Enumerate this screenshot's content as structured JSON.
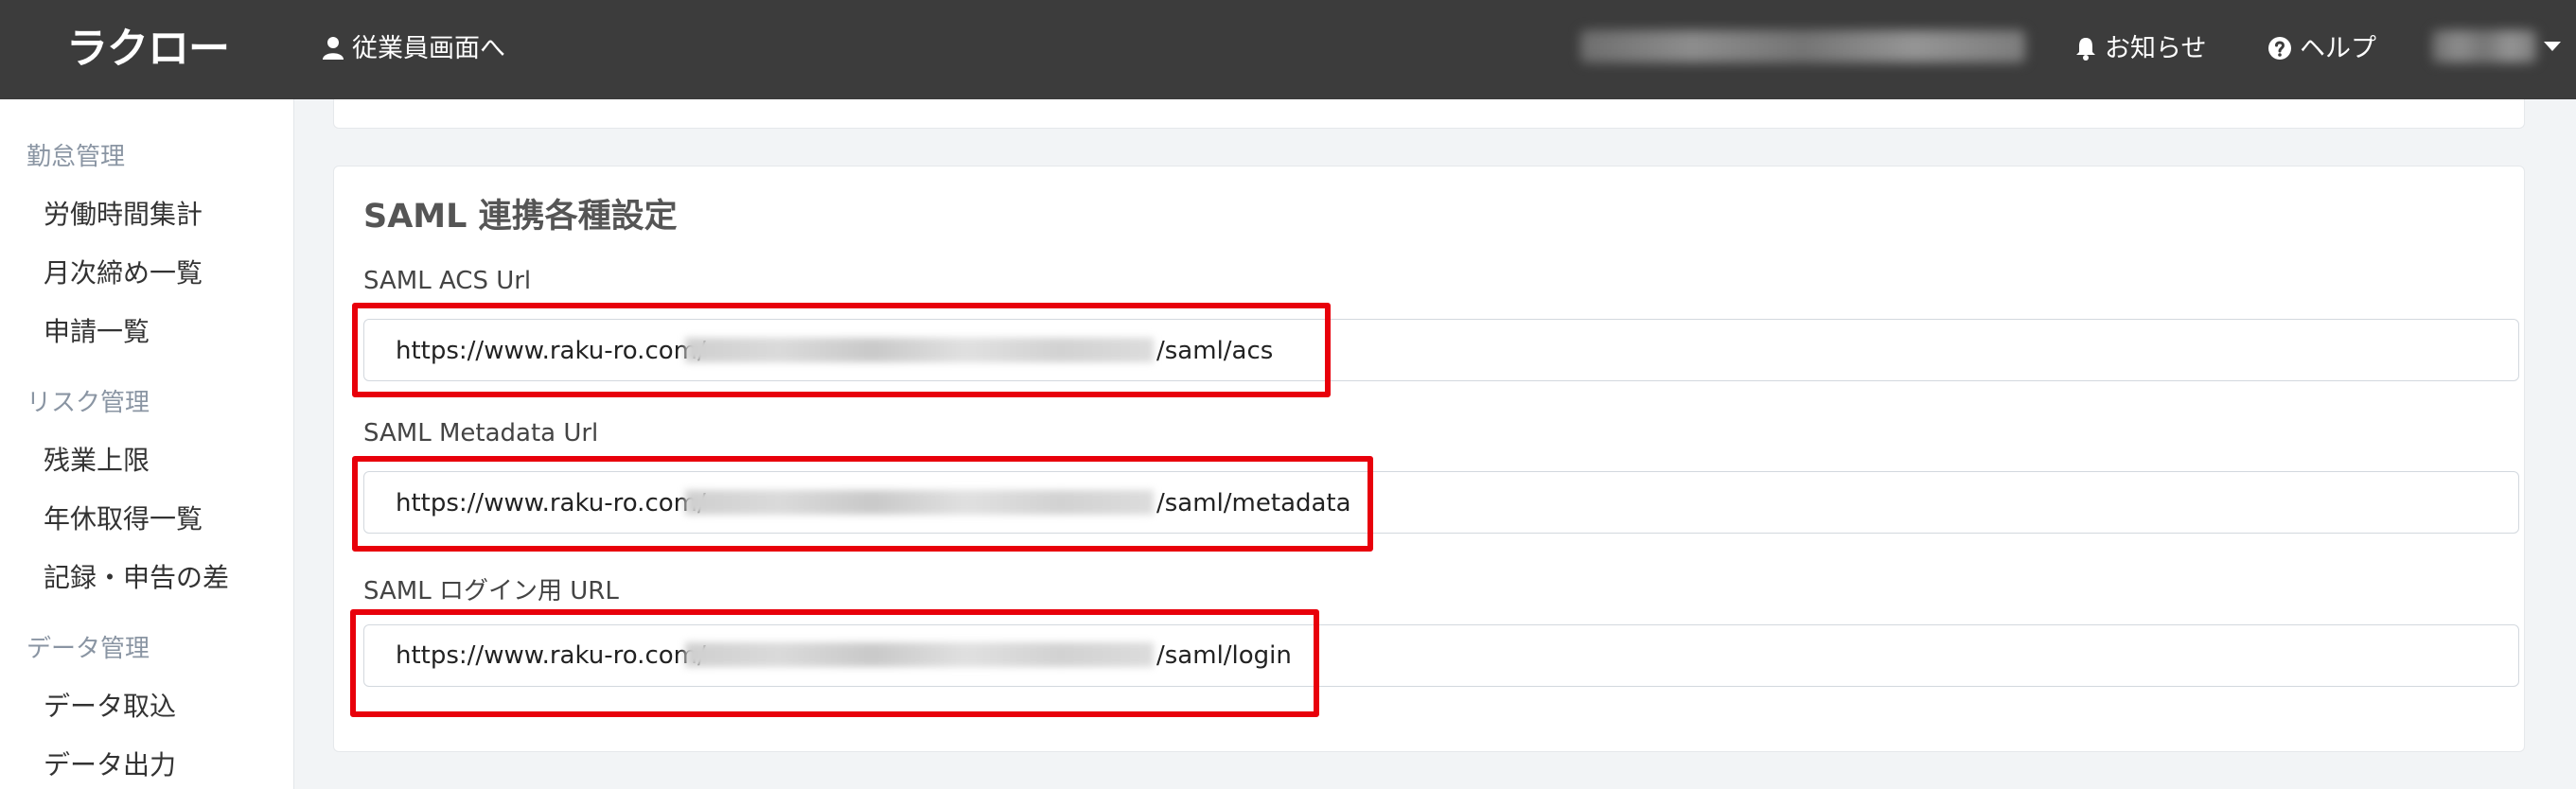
{
  "header": {
    "logo": "ラクロー",
    "employee_link": "従業員画面へ",
    "notifications": "お知らせ",
    "help": "ヘルプ"
  },
  "sidebar": {
    "sections": [
      {
        "title": "勤怠管理",
        "items": [
          "労働時間集計",
          "月次締め一覧",
          "申請一覧"
        ]
      },
      {
        "title": "リスク管理",
        "items": [
          "残業上限",
          "年休取得一覧",
          "記録・申告の差"
        ]
      },
      {
        "title": "データ管理",
        "items": [
          "データ取込",
          "データ出力"
        ]
      }
    ]
  },
  "main": {
    "card_title": "SAML 連携各種設定",
    "fields": [
      {
        "label": "SAML ACS Url",
        "prefix": "https://www.raku-ro.com/",
        "suffix": "/saml/acs"
      },
      {
        "label": "SAML Metadata Url",
        "prefix": "https://www.raku-ro.com/",
        "suffix": "/saml/metadata"
      },
      {
        "label": "SAML ログイン用 URL",
        "prefix": "https://www.raku-ro.com/",
        "suffix": "/saml/login"
      }
    ]
  },
  "colors": {
    "topbar": "#3c3c3c",
    "highlight": "#e8000b",
    "section_text": "#8a95a3"
  }
}
